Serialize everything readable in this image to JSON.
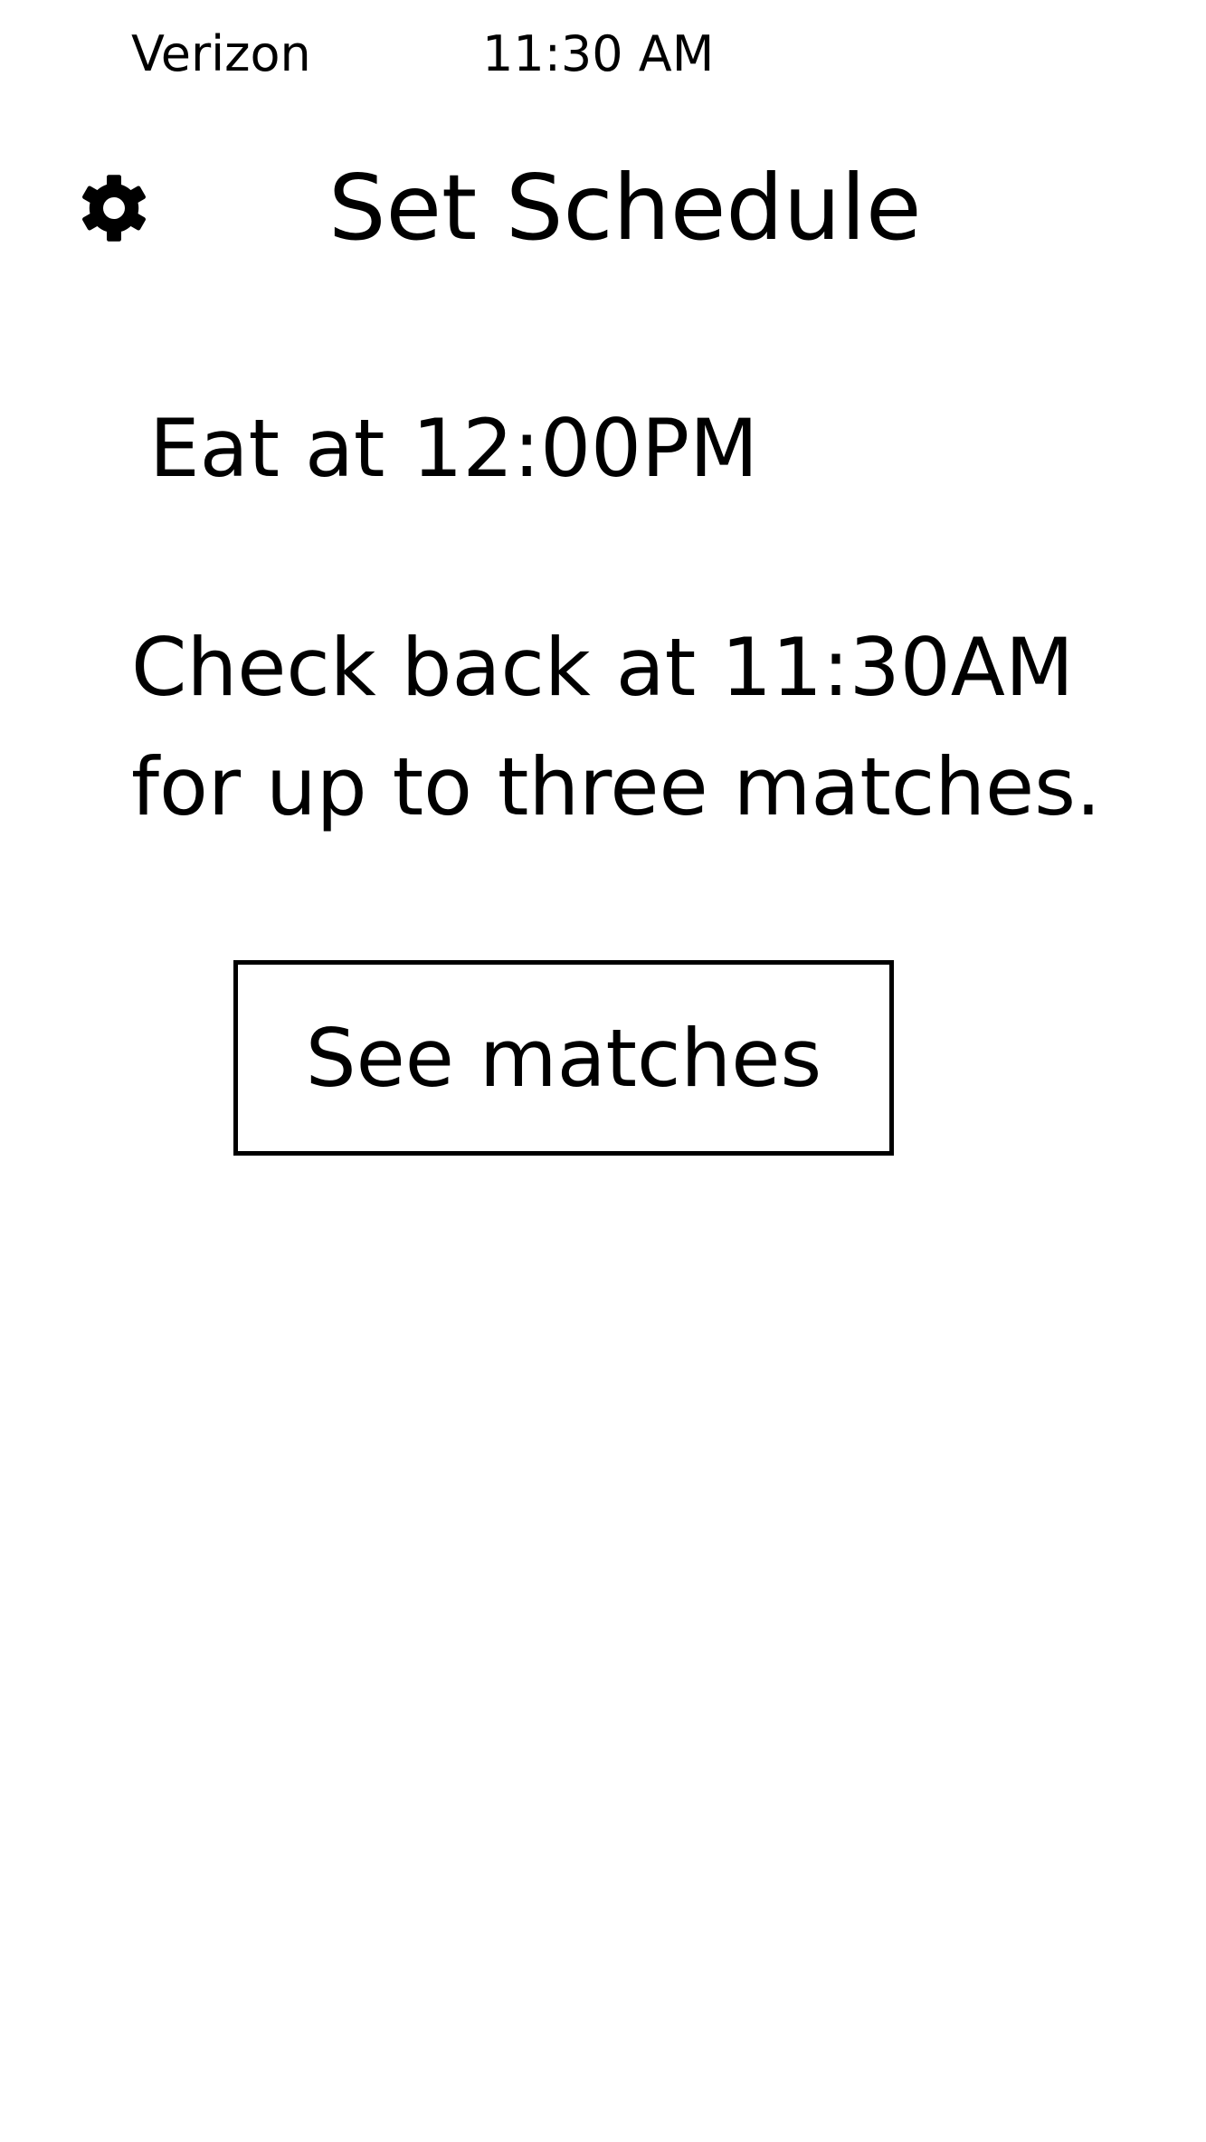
{
  "status_bar": {
    "carrier": "Verizon",
    "time": "11:30 AM"
  },
  "header": {
    "title": "Set Schedule",
    "settings_icon": "gear-icon"
  },
  "schedule": {
    "eat_label": "Eat at",
    "eat_time": "12:00PM"
  },
  "info": {
    "line1": "Check back at 11:30AM",
    "line2": "for up to three matches."
  },
  "actions": {
    "see_matches_label": "See matches"
  }
}
